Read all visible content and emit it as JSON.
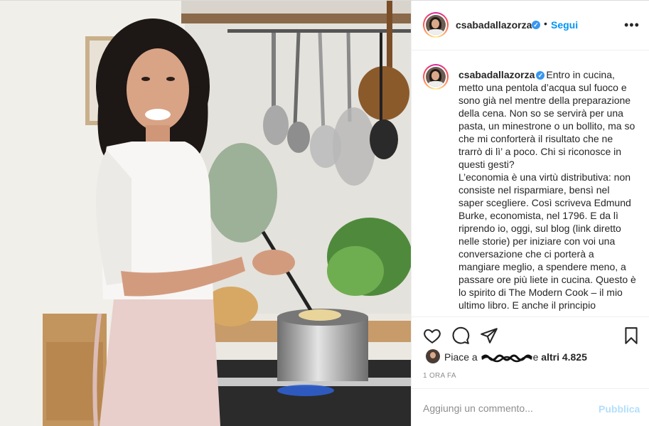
{
  "post": {
    "username": "csabadallazorza",
    "verified": true,
    "follow_label": "Segui",
    "separator": "•",
    "more_icon": "more-horizontal-icon"
  },
  "caption": {
    "username": "csabadallazorza",
    "text": "Entro in cucina, metto una pentola d’acqua sul fuoco e sono già nel mentre della preparazione della cena. Non so se servirà per una pasta, un minestrone o un bollito, ma so che mi conforterà il risultato che ne trarrò di lì’ a poco. Chi si riconosce in questi gesti?\nL’economia è una virtù distributiva: non consiste nel risparmiare, bensì nel saper scegliere. Così scriveva Edmund Burke, economista, nel 1796. E da lì riprendo io, oggi, sul blog (link diretto nelle storie) per iniziare con voi una conversazione che ci porterà a mangiare meglio, a spendere meno, a passare ore più liete in cucina. Questo è lo spirito di The Modern Cook – il mio ultimo libro. E anche il principio"
  },
  "actions": {
    "like_icon": "heart-icon",
    "comment_icon": "comment-icon",
    "share_icon": "share-icon",
    "save_icon": "bookmark-icon"
  },
  "likes": {
    "prefix": "Piace a",
    "redacted_name": "",
    "connector": "e",
    "others": "altri 4.825"
  },
  "timestamp": "1 ora fa",
  "comment": {
    "placeholder": "Aggiungi un commento...",
    "publish_label": "Pubblica"
  },
  "colors": {
    "link_blue": "#0095f6",
    "publish_disabled": "#b2dffc",
    "verified_blue": "#3897f0",
    "muted": "#8e8e8e"
  }
}
